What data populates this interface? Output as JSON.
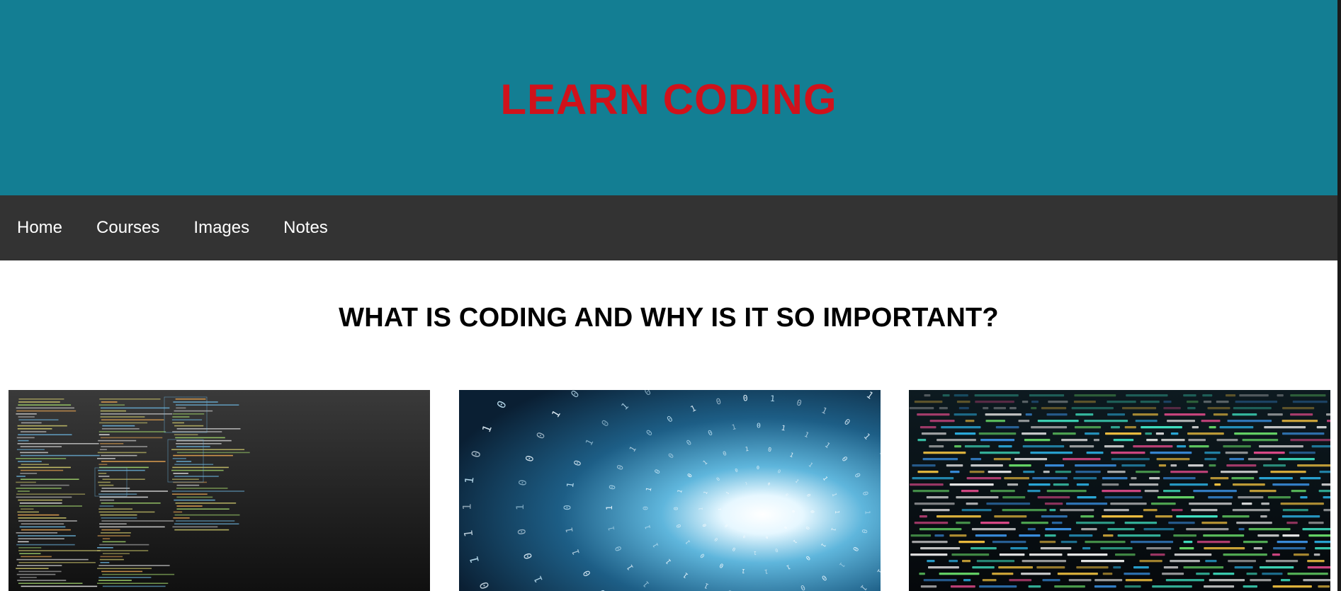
{
  "header": {
    "title": "LEARN CODING",
    "title_color": "#d0121b",
    "background": "#137e93"
  },
  "nav": {
    "background": "#333333",
    "items": [
      {
        "label": "Home"
      },
      {
        "label": "Courses"
      },
      {
        "label": "Images"
      },
      {
        "label": "Notes"
      }
    ]
  },
  "main": {
    "heading": "WHAT IS CODING AND WHY IS IT SO IMPORTANT?",
    "images": [
      {
        "name": "code-editor-screenshot",
        "description_icon": "dark-terminal-image"
      },
      {
        "name": "binary-tunnel",
        "description_icon": "binary-tunnel-image"
      },
      {
        "name": "colorful-source-code",
        "description_icon": "source-code-image"
      }
    ]
  }
}
